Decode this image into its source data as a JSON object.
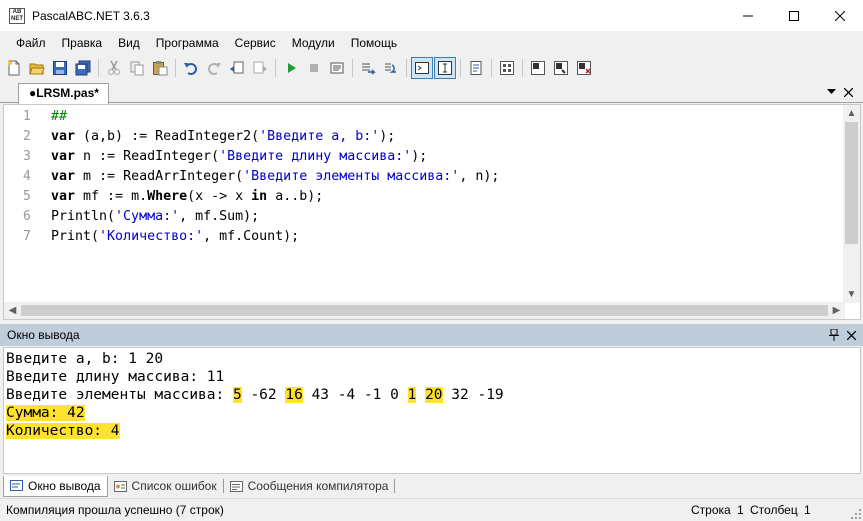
{
  "window": {
    "title": "PascalABC.NET 3.6.3",
    "app_icon_text": "AB\nNET"
  },
  "menu": [
    "Файл",
    "Правка",
    "Вид",
    "Программа",
    "Сервис",
    "Модули",
    "Помощь"
  ],
  "toolbar": {
    "buttons": [
      "new-icon",
      "open-icon",
      "save-icon",
      "save-all-icon",
      "cut-icon",
      "copy-icon",
      "paste-icon",
      "undo-icon",
      "redo-icon",
      "back-icon",
      "forward-icon",
      "run-icon",
      "stop-icon",
      "debug-icon",
      "step-icon",
      "output-window-icon",
      "form-icon",
      "format-icon",
      "properties-icon",
      "dotnet-icon",
      "compile-icon",
      "rebuild-icon"
    ]
  },
  "document_tab": {
    "label": "●LRSM.pas*"
  },
  "editor": {
    "line_numbers": [
      "1",
      "2",
      "3",
      "4",
      "5",
      "6",
      "7"
    ],
    "lines": [
      [
        {
          "t": "##",
          "c": "cm"
        }
      ],
      [
        {
          "t": "var",
          "c": "kw"
        },
        {
          "t": " (a,b) := ReadInteger2(",
          "c": ""
        },
        {
          "t": "'Введите a, b:'",
          "c": "str"
        },
        {
          "t": ");",
          "c": ""
        }
      ],
      [
        {
          "t": "var",
          "c": "kw"
        },
        {
          "t": " n := ReadInteger(",
          "c": ""
        },
        {
          "t": "'Введите длину массива:'",
          "c": "str"
        },
        {
          "t": ");",
          "c": ""
        }
      ],
      [
        {
          "t": "var",
          "c": "kw"
        },
        {
          "t": " m := ReadArrInteger(",
          "c": ""
        },
        {
          "t": "'Введите элементы массива:'",
          "c": "str"
        },
        {
          "t": ", n);",
          "c": ""
        }
      ],
      [
        {
          "t": "var",
          "c": "kw"
        },
        {
          "t": " mf := m.",
          "c": ""
        },
        {
          "t": "Where",
          "c": "kw"
        },
        {
          "t": "(x -> x ",
          "c": ""
        },
        {
          "t": "in",
          "c": "kw"
        },
        {
          "t": " a..b);",
          "c": ""
        }
      ],
      [
        {
          "t": "Println(",
          "c": ""
        },
        {
          "t": "'Сумма:'",
          "c": "str"
        },
        {
          "t": ", mf.Sum);",
          "c": ""
        }
      ],
      [
        {
          "t": "Print(",
          "c": ""
        },
        {
          "t": "'Количество:'",
          "c": "str"
        },
        {
          "t": ", mf.Count);",
          "c": ""
        }
      ]
    ]
  },
  "output": {
    "title": "Окно вывода",
    "lines": [
      [
        {
          "t": "Введите a, b: 1 20",
          "h": false
        }
      ],
      [
        {
          "t": "Введите длину массива: 11",
          "h": false
        }
      ],
      [
        {
          "t": "Введите элементы массива: ",
          "h": false
        },
        {
          "t": "5",
          "h": true
        },
        {
          "t": " -62 ",
          "h": false
        },
        {
          "t": "16",
          "h": true
        },
        {
          "t": " 43 -4 -1 0 ",
          "h": false
        },
        {
          "t": "1",
          "h": true
        },
        {
          "t": " ",
          "h": false
        },
        {
          "t": "20",
          "h": true
        },
        {
          "t": " 32 -19",
          "h": false
        }
      ],
      [
        {
          "t": "Сумма: 42",
          "h": true
        }
      ],
      [
        {
          "t": "Количество: 4",
          "h": true
        }
      ]
    ],
    "highlight_color": "#ffe22e"
  },
  "bottom_tabs": [
    {
      "label": "Окно вывода",
      "icon": "output-window-icon",
      "active": true
    },
    {
      "label": "Список ошибок",
      "icon": "error-list-icon",
      "active": false
    },
    {
      "label": "Сообщения компилятора",
      "icon": "compiler-messages-icon",
      "active": false
    }
  ],
  "status": {
    "message": "Компиляция прошла успешно (7 строк)",
    "row_label": "Строка",
    "row_value": "1",
    "col_label": "Столбец",
    "col_value": "1"
  }
}
